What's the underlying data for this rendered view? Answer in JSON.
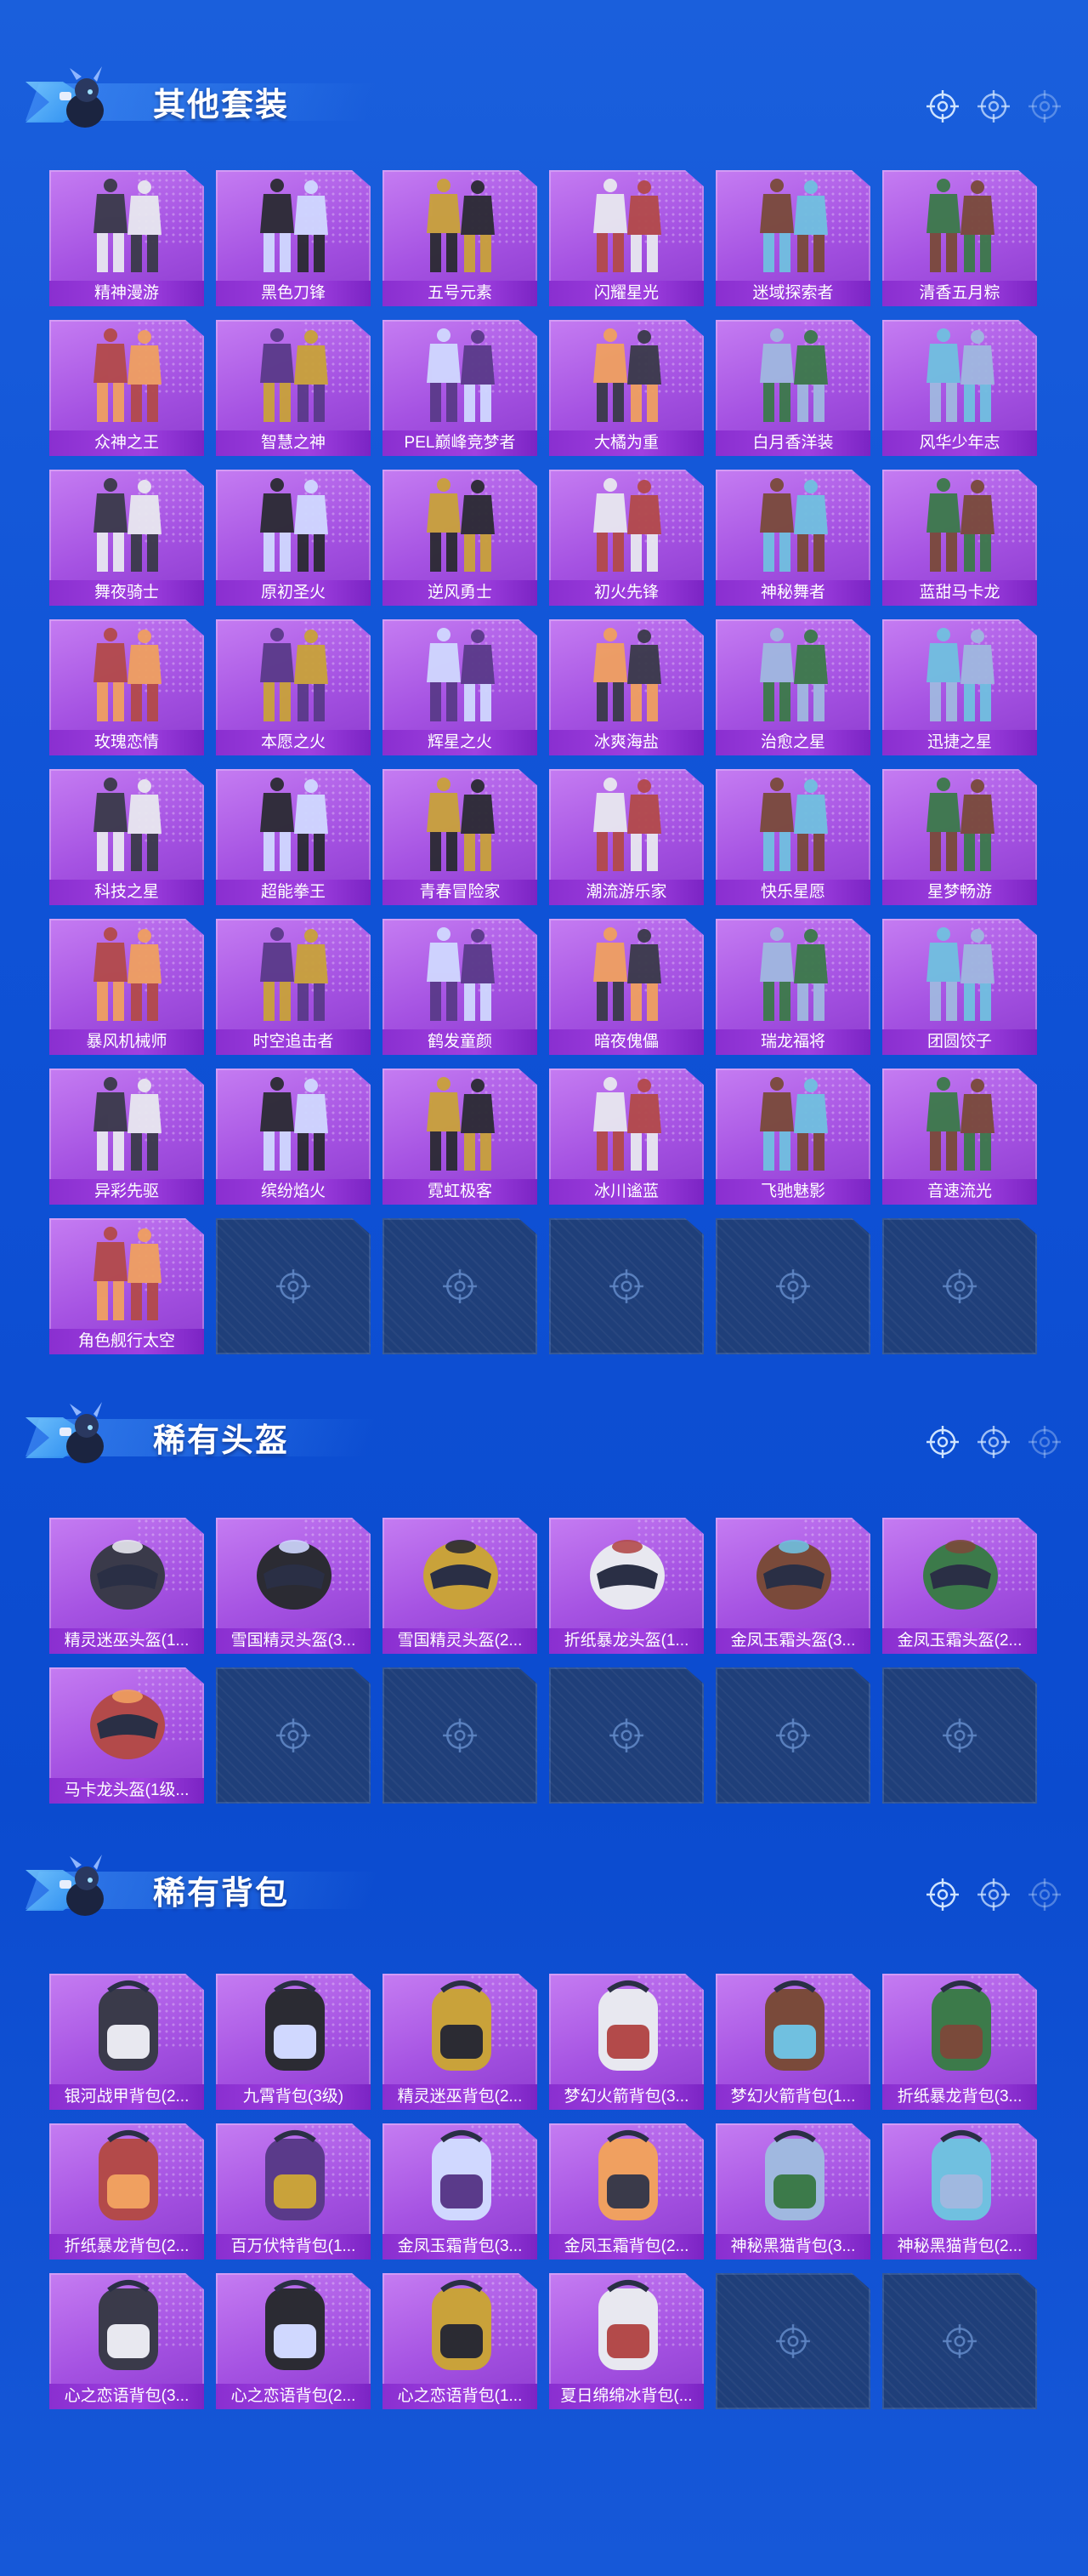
{
  "colors": {
    "background": "#0f52d6",
    "card_purple": "#a552e2",
    "label_purple": "#8a2fd0",
    "empty_slot": "#1f3f7a"
  },
  "icons": {
    "header_mascot": "mascot-icon",
    "header_decor": "crosshair-icon",
    "empty_slot": "crosshair-icon"
  },
  "sections": {
    "outfits": {
      "title": "其他套装",
      "items": [
        "精神漫游",
        "黑色刀锋",
        "五号元素",
        "闪耀星光",
        "迷域探索者",
        "清香五月粽",
        "众神之王",
        "智慧之神",
        "PEL巅峰竞梦者",
        "大橘为重",
        "白月香洋装",
        "风华少年志",
        "舞夜骑士",
        "原初圣火",
        "逆风勇士",
        "初火先锋",
        "神秘舞者",
        "蓝甜马卡龙",
        "玫瑰恋情",
        "本愿之火",
        "辉星之火",
        "冰爽海盐",
        "治愈之星",
        "迅捷之星",
        "科技之星",
        "超能拳王",
        "青春冒险家",
        "潮流游乐家",
        "快乐星愿",
        "星梦畅游",
        "暴风机械师",
        "时空追击者",
        "鹤发童颜",
        "暗夜傀儡",
        "瑞龙福将",
        "团圆饺子",
        "异彩先驱",
        "缤纷焰火",
        "霓虹极客",
        "冰川谧蓝",
        "飞驰魅影",
        "音速流光",
        "角色舰行太空"
      ]
    },
    "helmets": {
      "title": "稀有头盔",
      "items": [
        "精灵迷巫头盔(1...",
        "雪国精灵头盔(3...",
        "雪国精灵头盔(2...",
        "折纸暴龙头盔(1...",
        "金凤玉霜头盔(3...",
        "金凤玉霜头盔(2...",
        "马卡龙头盔(1级..."
      ]
    },
    "backpacks": {
      "title": "稀有背包",
      "items": [
        "银河战甲背包(2...",
        "九霄背包(3级)",
        "精灵迷巫背包(2...",
        "梦幻火箭背包(3...",
        "梦幻火箭背包(1...",
        "折纸暴龙背包(3...",
        "折纸暴龙背包(2...",
        "百万伏特背包(1...",
        "金凤玉霜背包(3...",
        "金凤玉霜背包(2...",
        "神秘黑猫背包(3...",
        "神秘黑猫背包(2...",
        "心之恋语背包(3...",
        "心之恋语背包(2...",
        "心之恋语背包(1...",
        "夏日绵绵冰背包(..."
      ]
    }
  }
}
